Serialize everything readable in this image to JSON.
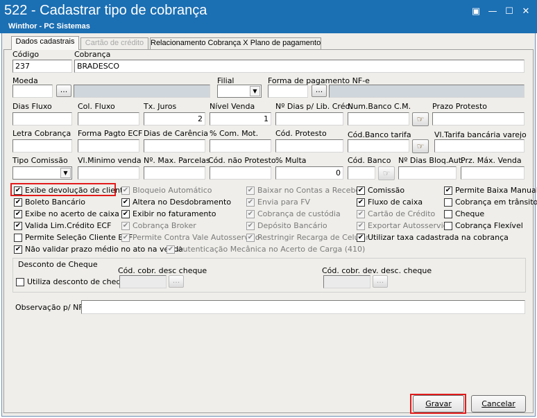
{
  "window": {
    "title": "522 - Cadastrar tipo de cobrança",
    "subtitle": "Winthor - PC Sistemas",
    "controls": {
      "restore": "▣",
      "minimize": "—",
      "maximize": "☐",
      "close": "✕"
    }
  },
  "tabs": [
    {
      "label": "Dados cadastrais",
      "state": "active"
    },
    {
      "label": "Cartão de crédito",
      "state": "disabled"
    },
    {
      "label": "Relacionamento Cobrança X Plano de pagamento",
      "state": "normal"
    }
  ],
  "fields": {
    "codigo": {
      "label": "Código",
      "value": "237"
    },
    "cobranca": {
      "label": "Cobrança",
      "value": "BRADESCO"
    },
    "moeda": {
      "label": "Moeda",
      "value": ""
    },
    "filial": {
      "label": "Filial",
      "value": ""
    },
    "forma_pagamento_nfe": {
      "label": "Forma de pagamento NF-e",
      "value": ""
    },
    "dias_fluxo": {
      "label": "Dias Fluxo",
      "value": ""
    },
    "col_fluxo": {
      "label": "Col. Fluxo",
      "value": ""
    },
    "tx_juros": {
      "label": "Tx. Juros",
      "value": "2"
    },
    "nivel_venda": {
      "label": "Nível Venda",
      "value": "1"
    },
    "dias_lib_cred": {
      "label": "Nº Dias p/ Lib. Créd.",
      "value": ""
    },
    "num_banco_cm": {
      "label": "Num.Banco C.M.",
      "value": ""
    },
    "prazo_protesto": {
      "label": "Prazo Protesto",
      "value": ""
    },
    "letra_cobranca": {
      "label": "Letra Cobrança",
      "value": ""
    },
    "forma_pagto_ecf": {
      "label": "Forma Pagto ECF",
      "value": ""
    },
    "dias_carencia": {
      "label": "Dias de Carência",
      "value": ""
    },
    "com_mot": {
      "label": "% Com. Mot.",
      "value": ""
    },
    "cod_protesto": {
      "label": "Cód. Protesto",
      "value": ""
    },
    "cod_banco_tarifa": {
      "label": "Cód.Banco tarifa",
      "value": ""
    },
    "vl_tarifa": {
      "label": "Vl.Tarifa bancária varejo",
      "value": ""
    },
    "tipo_comissao": {
      "label": "Tipo Comissão",
      "value": ""
    },
    "vl_minimo_venda": {
      "label": "Vl.Minimo venda",
      "value": ""
    },
    "max_parcelas": {
      "label": "Nº. Max. Parcelas",
      "value": ""
    },
    "cod_nao_protesto": {
      "label": "Cód. não Protesto.",
      "value": ""
    },
    "multa": {
      "label": "% Multa",
      "value": "0"
    },
    "cod_banco": {
      "label": "Cód. Banco",
      "value": ""
    },
    "dias_bloq_aut": {
      "label": "Nº Dias Bloq.Aut.",
      "value": ""
    },
    "prz_max_venda": {
      "label": "Prz. Máx. Venda",
      "value": ""
    }
  },
  "ellipsis": "...",
  "checkboxes": {
    "exibe_devolucao": {
      "label": "Exibe devolução de cliente",
      "checked": true,
      "enabled": true
    },
    "boleto_bancario": {
      "label": "Boleto Bancário",
      "checked": true,
      "enabled": true
    },
    "exibe_acerto": {
      "label": "Exibe no acerto de caixa",
      "checked": true,
      "enabled": true
    },
    "valida_lim": {
      "label": "Valida Lim.Crédito ECF",
      "checked": true,
      "enabled": true
    },
    "permite_selecao": {
      "label": "Permite Seleção Cliente ECF",
      "checked": false,
      "enabled": true
    },
    "nao_validar_prazo": {
      "label": "Não validar prazo médio no ato na venda",
      "checked": true,
      "enabled": true
    },
    "bloqueio_automatico": {
      "label": "Bloqueio Automático",
      "checked": true,
      "enabled": false
    },
    "altera_desdobramento": {
      "label": "Altera no Desdobramento",
      "checked": true,
      "enabled": true
    },
    "exibir_faturamento": {
      "label": "Exibir no faturamento",
      "checked": true,
      "enabled": true
    },
    "cobranca_broker": {
      "label": "Cobrança Broker",
      "checked": true,
      "enabled": false
    },
    "permite_contra_vale": {
      "label": "Permite Contra Vale Autosserviço",
      "checked": true,
      "enabled": false
    },
    "autenticacao_mecanica": {
      "label": "Autenticação Mecânica no Acerto de Carga (410)",
      "checked": true,
      "enabled": false
    },
    "baixar_contas": {
      "label": "Baixar no Contas a Receber",
      "checked": true,
      "enabled": false
    },
    "envia_fv": {
      "label": "Envia para FV",
      "checked": true,
      "enabled": false
    },
    "cobranca_custodia": {
      "label": "Cobrança de custódia",
      "checked": true,
      "enabled": false
    },
    "deposito_bancario": {
      "label": "Depósito Bancário",
      "checked": true,
      "enabled": false
    },
    "restringir_recarga": {
      "label": "Restringir Recarga de Celular",
      "checked": true,
      "enabled": false
    },
    "comissao": {
      "label": "Comissão",
      "checked": true,
      "enabled": true
    },
    "fluxo_caixa": {
      "label": "Fluxo de caixa",
      "checked": true,
      "enabled": true
    },
    "cartao_credito": {
      "label": "Cartão de Crédito",
      "checked": true,
      "enabled": false
    },
    "exportar_autosservico": {
      "label": "Exportar Autosserviço",
      "checked": true,
      "enabled": false
    },
    "utilizar_taxa": {
      "label": "Utilizar taxa cadastrada na cobrança",
      "checked": true,
      "enabled": true
    },
    "permite_baixa_manual": {
      "label": "Permite Baixa Manual",
      "checked": true,
      "enabled": true
    },
    "cobranca_transito": {
      "label": "Cobrança em trânsito",
      "checked": false,
      "enabled": true
    },
    "cheque": {
      "label": "Cheque",
      "checked": false,
      "enabled": true
    },
    "cobranca_flexivel": {
      "label": "Cobrança Flexível",
      "checked": false,
      "enabled": true
    }
  },
  "desconto_cheque": {
    "title": "Desconto de Cheque",
    "utiliza_label": "Utiliza desconto de cheque",
    "cod_desc_label": "Cód. cobr. desc cheque",
    "cod_dev_label": "Cód. cobr. dev. desc. cheque"
  },
  "observacao": {
    "label": "Observação p/ NF:",
    "value": ""
  },
  "buttons": {
    "gravar": "Gravar",
    "cancelar": "Cancelar"
  },
  "icons": {
    "hand": "☞",
    "check": "✔"
  }
}
